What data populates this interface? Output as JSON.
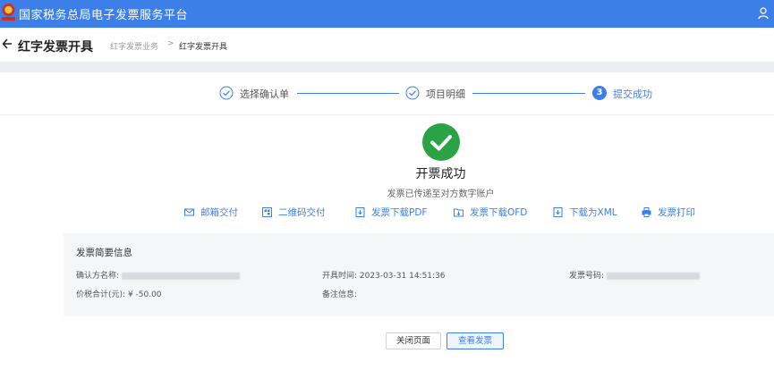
{
  "app": {
    "title": "国家税务总局电子发票服务平台"
  },
  "header": {
    "page_title": "红字发票开具",
    "breadcrumb": [
      "红字发票业务",
      "红字发票开具"
    ],
    "breadcrumb_separator": ">"
  },
  "steps": [
    {
      "label": "选择确认单",
      "status": "done"
    },
    {
      "label": "项目明细",
      "status": "done"
    },
    {
      "number": "3",
      "label": "提交成功",
      "status": "active"
    }
  ],
  "result": {
    "title": "开票成功",
    "subtitle": "发票已传递至对方数字账户"
  },
  "actions": [
    {
      "label": "邮箱交付",
      "icon": "mail-icon"
    },
    {
      "label": "二维码交付",
      "icon": "qrcode-icon"
    },
    {
      "label": "发票下载PDF",
      "icon": "download-icon"
    },
    {
      "label": "发票下载OFD",
      "icon": "download-icon"
    },
    {
      "label": "下载为XML",
      "icon": "download-icon"
    },
    {
      "label": "发票打印",
      "icon": "printer-icon"
    }
  ],
  "summary": {
    "title": "发票简要信息",
    "confirm_party_label": "确认方名称:",
    "issue_time_label": "开具时间:",
    "issue_time_value": "2023-03-31 14:51:36",
    "invoice_no_label": "发票号码:",
    "total_label": "价税合计(元):",
    "total_value": "¥ -50.00",
    "remark_label": "备注信息:"
  },
  "buttons": {
    "close": "关闭页面",
    "view": "查看发票"
  },
  "colors": {
    "primary": "#3d7fe8",
    "success": "#2ba245",
    "header_bg": "#3d7fe8"
  }
}
